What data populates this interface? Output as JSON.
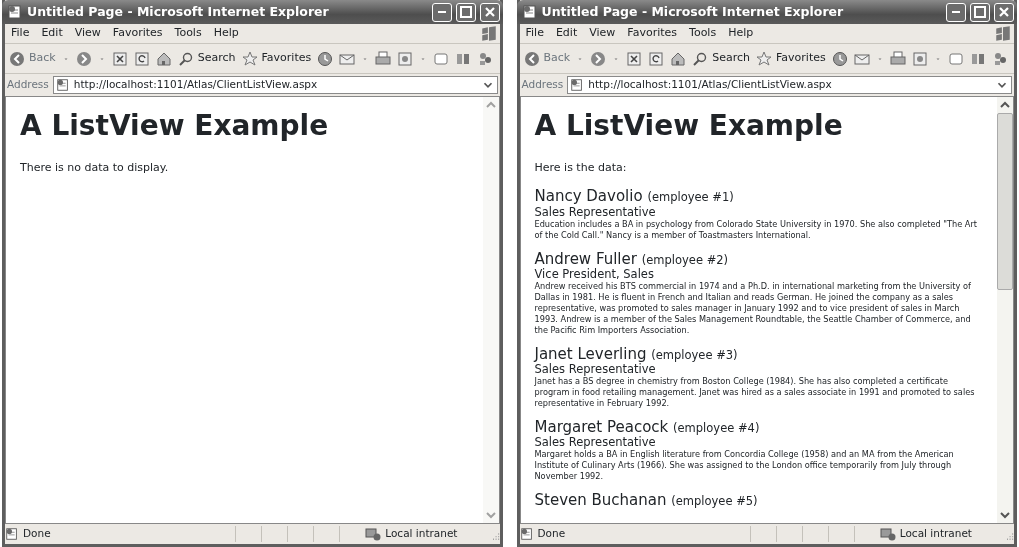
{
  "windows": [
    {
      "title": "Untitled Page - Microsoft Internet Explorer",
      "menu": [
        "File",
        "Edit",
        "View",
        "Favorites",
        "Tools",
        "Help"
      ],
      "toolbar": {
        "back": "Back",
        "search": "Search",
        "favorites": "Favorites"
      },
      "address": {
        "label": "Address",
        "value": "http://localhost:1101/Atlas/ClientListView.aspx"
      },
      "scrollbar_enabled": false,
      "page": {
        "heading": "A ListView Example",
        "intro": "There is no data to display."
      },
      "status": {
        "text": "Done",
        "zone": "Local intranet"
      }
    },
    {
      "title": "Untitled Page - Microsoft Internet Explorer",
      "menu": [
        "File",
        "Edit",
        "View",
        "Favorites",
        "Tools",
        "Help"
      ],
      "toolbar": {
        "back": "Back",
        "search": "Search",
        "favorites": "Favorites"
      },
      "address": {
        "label": "Address",
        "value": "http://localhost:1101/Atlas/ClientListView.aspx"
      },
      "scrollbar_enabled": true,
      "page": {
        "heading": "A ListView Example",
        "intro": "Here is the data:",
        "employees": [
          {
            "name": "Nancy Davolio",
            "number": "(employee #1)",
            "title": "Sales Representative",
            "notes": "Education includes a BA in psychology from Colorado State University in 1970. She also completed \"The Art of the Cold Call.\" Nancy is a member of Toastmasters International."
          },
          {
            "name": "Andrew Fuller",
            "number": "(employee #2)",
            "title": "Vice President, Sales",
            "notes": "Andrew received his BTS commercial in 1974 and a Ph.D. in international marketing from the University of Dallas in 1981. He is fluent in French and Italian and reads German. He joined the company as a sales representative, was promoted to sales manager in January 1992 and to vice president of sales in March 1993. Andrew is a member of the Sales Management Roundtable, the Seattle Chamber of Commerce, and the Pacific Rim Importers Association."
          },
          {
            "name": "Janet Leverling",
            "number": "(employee #3)",
            "title": "Sales Representative",
            "notes": "Janet has a BS degree in chemistry from Boston College (1984). She has also completed a certificate program in food retailing management. Janet was hired as a sales associate in 1991 and promoted to sales representative in February 1992."
          },
          {
            "name": "Margaret Peacock",
            "number": "(employee #4)",
            "title": "Sales Representative",
            "notes": "Margaret holds a BA in English literature from Concordia College (1958) and an MA from the American Institute of Culinary Arts (1966). She was assigned to the London office temporarily from July through November 1992."
          },
          {
            "name": "Steven Buchanan",
            "number": "(employee #5)"
          }
        ]
      },
      "status": {
        "text": "Done",
        "zone": "Local intranet"
      }
    }
  ]
}
